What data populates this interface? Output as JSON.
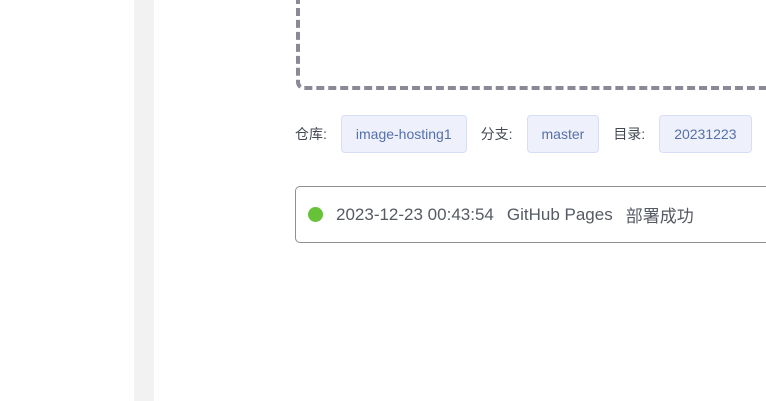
{
  "colors": {
    "gutter": "#f2f2f2",
    "tag_background": "#eef1fc",
    "tag_text": "#5670a8",
    "status_success": "#67c23a",
    "dashed_border": "#8a8a96"
  },
  "repo_info": {
    "repo_label": "仓库:",
    "repo_value": "image-hosting1",
    "branch_label": "分支:",
    "branch_value": "master",
    "dir_label": "目录:",
    "dir_value": "20231223"
  },
  "deploy_status": {
    "timestamp": "2023-12-23 00:43:54",
    "service": "GitHub Pages",
    "message": "部署成功",
    "state_icon": "status-success-dot"
  }
}
